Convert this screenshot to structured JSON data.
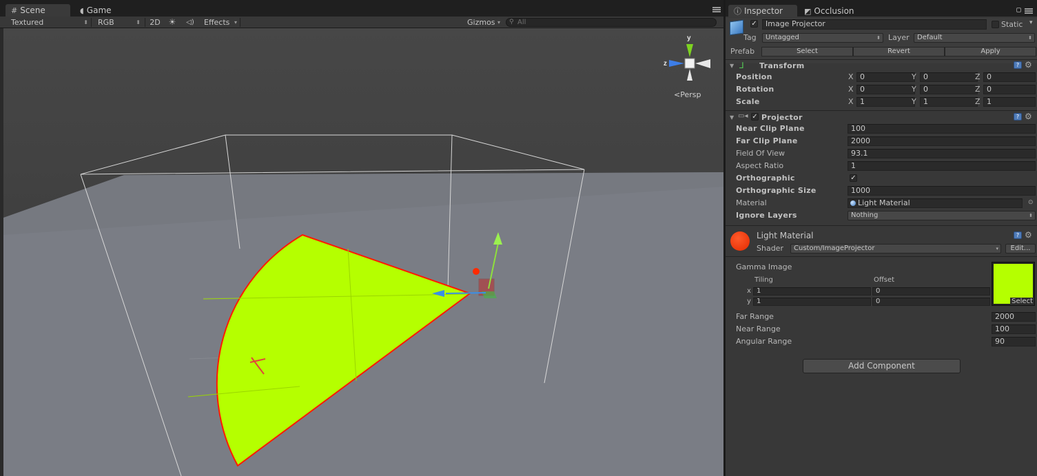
{
  "scene_tabs": [
    {
      "label": "Scene",
      "icon": "hashtag-grid-icon"
    },
    {
      "label": "Game",
      "icon": "pacman-icon"
    }
  ],
  "scene_toolbar": {
    "render_mode": "Textured",
    "channel": "RGB",
    "mode_2d": "2D",
    "effects": "Effects",
    "gizmos": "Gizmos",
    "search_placeholder": "All"
  },
  "scene_gizmo": {
    "y_label": "y",
    "z_label": "z",
    "projection": "Persp"
  },
  "colors": {
    "projected_image": "#b5ff00",
    "material_swatch": "#ff2200",
    "ground": "#7a7d85",
    "sky": "#3b3b3b"
  },
  "inspector": {
    "tabs": [
      {
        "label": "Inspector",
        "icon": "info-icon"
      },
      {
        "label": "Occlusion",
        "icon": "occlusion-icon"
      }
    ],
    "object": {
      "active": true,
      "name": "Image Projector",
      "static_label": "Static",
      "static": false
    },
    "tag_label": "Tag",
    "tag_value": "Untagged",
    "layer_label": "Layer",
    "layer_value": "Default",
    "prefab_label": "Prefab",
    "prefab_buttons": [
      "Select",
      "Revert",
      "Apply"
    ],
    "transform": {
      "title": "Transform",
      "rows": [
        {
          "label": "Position",
          "x": "0",
          "y": "0",
          "z": "0"
        },
        {
          "label": "Rotation",
          "x": "0",
          "y": "0",
          "z": "0"
        },
        {
          "label": "Scale",
          "x": "1",
          "y": "1",
          "z": "1"
        }
      ]
    },
    "projector": {
      "title": "Projector",
      "enabled": true,
      "near_clip_label": "Near Clip Plane",
      "near_clip": "100",
      "far_clip_label": "Far Clip Plane",
      "far_clip": "2000",
      "fov_label": "Field Of View",
      "fov": "93.1",
      "aspect_label": "Aspect Ratio",
      "aspect": "1",
      "ortho_label": "Orthographic",
      "ortho": true,
      "ortho_size_label": "Orthographic Size",
      "ortho_size": "1000",
      "material_label": "Material",
      "material": "Light Material",
      "ignore_layers_label": "Ignore Layers",
      "ignore_layers": "Nothing"
    },
    "material": {
      "name": "Light Material",
      "shader_label": "Shader",
      "shader": "Custom/ImageProjector",
      "edit_button": "Edit...",
      "texture_label": "Gamma Image",
      "tiling_label": "Tiling",
      "offset_label": "Offset",
      "tiling_x": "1",
      "tiling_y": "1",
      "offset_x": "0",
      "offset_y": "0",
      "x_label": "x",
      "y_label": "y",
      "texture_select": "Select",
      "far_range_label": "Far Range",
      "far_range": "2000",
      "near_range_label": "Near Range",
      "near_range": "100",
      "angular_range_label": "Angular Range",
      "angular_range": "90"
    },
    "add_component": "Add Component"
  }
}
